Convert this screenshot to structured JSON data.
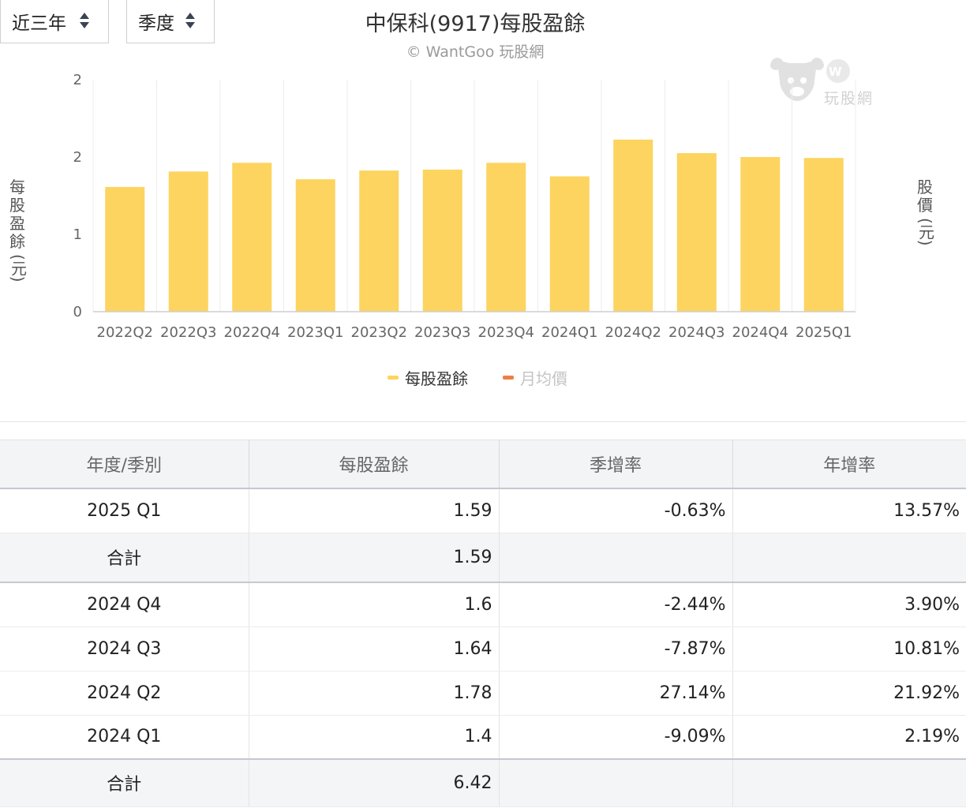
{
  "controls": {
    "range_select": "近三年",
    "period_select": "季度"
  },
  "chart_data": {
    "type": "bar",
    "title": "中保科(9917)每股盈餘",
    "subtitle": "© WantGoo 玩股網",
    "categories": [
      "2022Q2",
      "2022Q3",
      "2022Q4",
      "2023Q1",
      "2023Q2",
      "2023Q3",
      "2023Q4",
      "2024Q1",
      "2024Q2",
      "2024Q3",
      "2024Q4",
      "2025Q1"
    ],
    "series": [
      {
        "name": "每股盈餘",
        "values": [
          1.29,
          1.45,
          1.54,
          1.37,
          1.46,
          1.47,
          1.54,
          1.4,
          1.78,
          1.64,
          1.6,
          1.59
        ],
        "color": "#fcd45f"
      },
      {
        "name": "月均價",
        "values": [],
        "color": "#f07e43"
      }
    ],
    "ylabel": "每股盈餘 (元)",
    "y2label": "股價 (元)",
    "ylim": [
      0,
      2.4
    ],
    "yticks": [
      0,
      0.8,
      1.6,
      2.4
    ],
    "ytick_labels": [
      "0",
      "1",
      "2",
      "2"
    ],
    "grid": "vertical",
    "legend": "bottom-center"
  },
  "watermark_text": "玩股網",
  "table": {
    "headers": [
      "年度/季別",
      "每股盈餘",
      "季增率",
      "年增率"
    ],
    "rows": [
      {
        "type": "row",
        "cells": [
          "2025 Q1",
          "1.59",
          "-0.63%",
          "13.57%"
        ]
      },
      {
        "type": "subtotal",
        "cells": [
          "合計",
          "1.59",
          "",
          ""
        ]
      },
      {
        "type": "row",
        "cells": [
          "2024 Q4",
          "1.6",
          "-2.44%",
          "3.90%"
        ]
      },
      {
        "type": "row",
        "cells": [
          "2024 Q3",
          "1.64",
          "-7.87%",
          "10.81%"
        ]
      },
      {
        "type": "row",
        "cells": [
          "2024 Q2",
          "1.78",
          "27.14%",
          "21.92%"
        ]
      },
      {
        "type": "row",
        "cells": [
          "2024 Q1",
          "1.4",
          "-9.09%",
          "2.19%"
        ]
      },
      {
        "type": "subtotal-last",
        "cells": [
          "合計",
          "6.42",
          "",
          ""
        ]
      }
    ]
  }
}
